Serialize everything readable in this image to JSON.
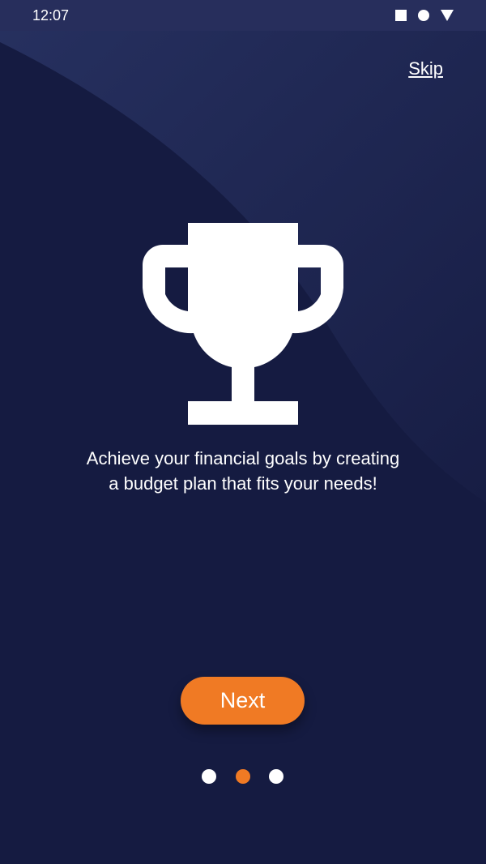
{
  "status_bar": {
    "time": "12:07",
    "icons": [
      "square-icon",
      "circle-icon",
      "triangle-icon"
    ]
  },
  "skip_label": "Skip",
  "illustration": {
    "icon": "trophy-icon"
  },
  "message": {
    "line1": "Achieve your financial goals by creating",
    "line2": "a budget plan that fits your needs!"
  },
  "next_label": "Next",
  "pagination": {
    "total": 3,
    "active_index": 1
  },
  "colors": {
    "background": "#151b41",
    "status_bar": "#272e5c",
    "curve_gradient_start": "#26305f",
    "curve_gradient_end": "#171d44",
    "accent": "#f07a24",
    "text": "#ffffff"
  }
}
